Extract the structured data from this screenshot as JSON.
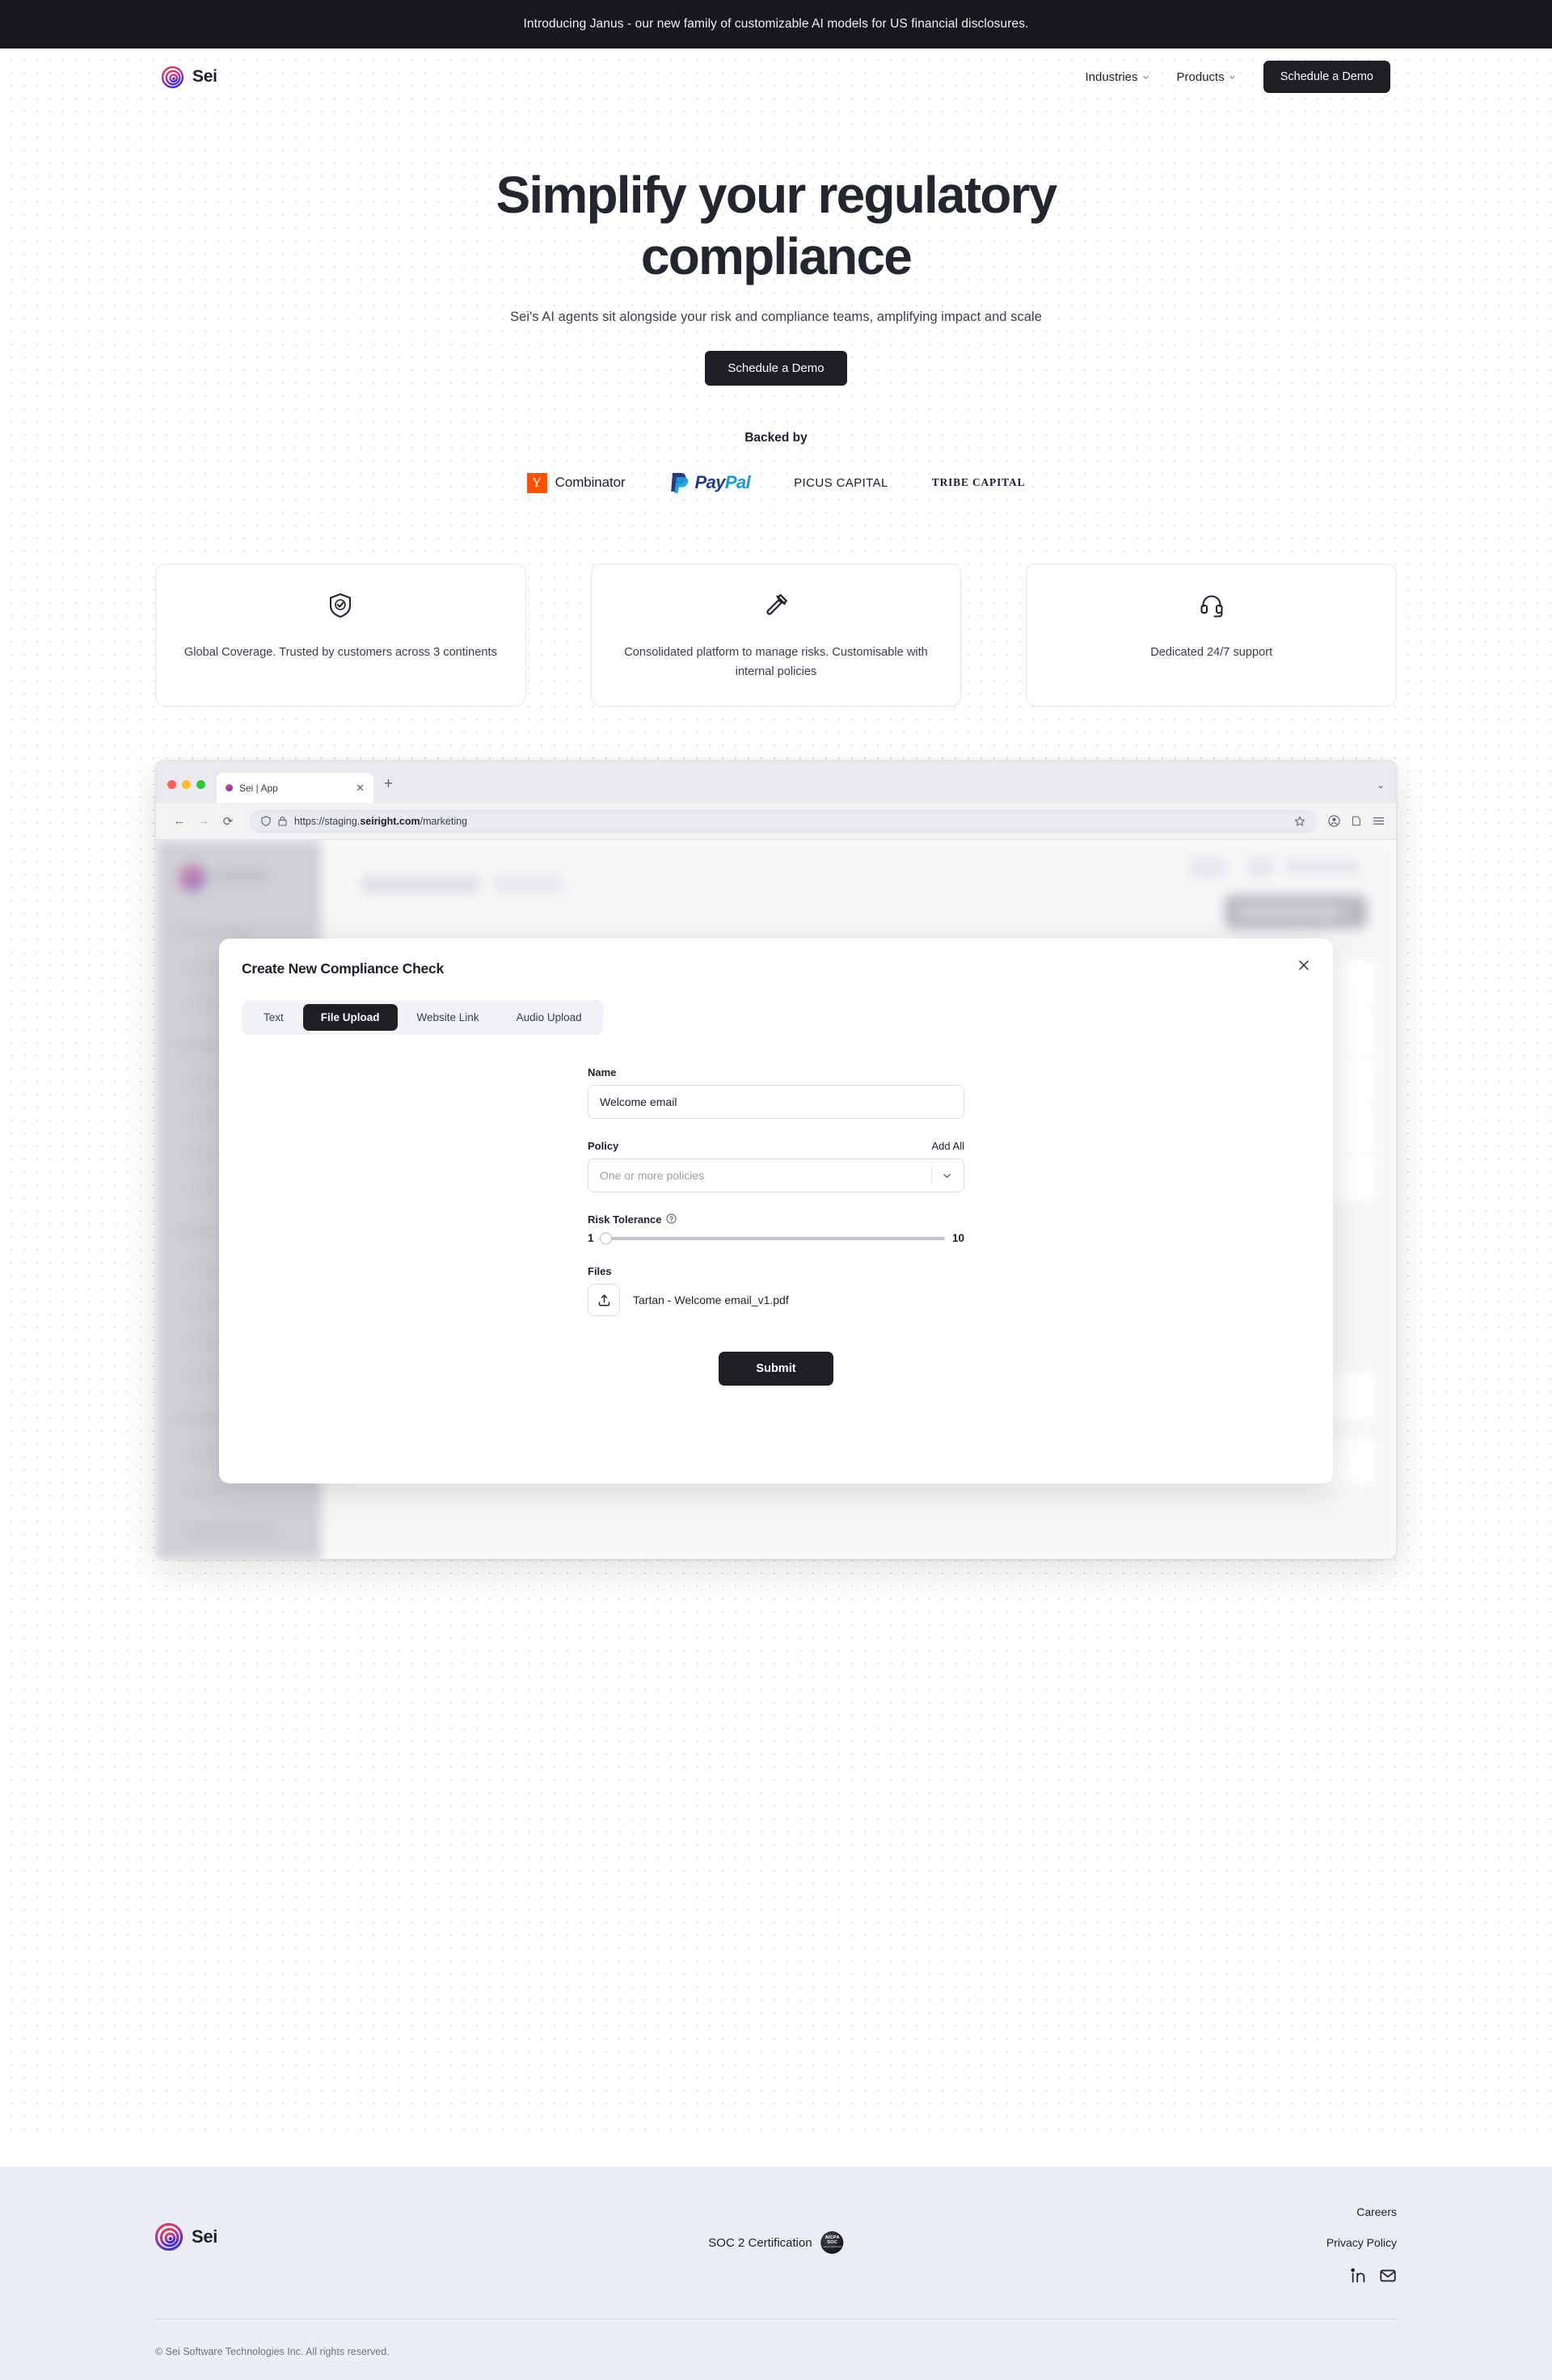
{
  "announcement": {
    "text": "Introducing Janus - our new family of customizable AI models for US financial disclosures."
  },
  "nav": {
    "brand": "Sei",
    "links": [
      {
        "label": "Industries"
      },
      {
        "label": "Products"
      }
    ],
    "cta": "Schedule a Demo"
  },
  "hero": {
    "heading": "Simplify your regulatory compliance",
    "subheading": "Sei's AI agents sit alongside your risk and compliance teams, amplifying impact and scale",
    "cta": "Schedule a Demo"
  },
  "backed_by": {
    "title": "Backed by",
    "logos": [
      {
        "name": "y-combinator",
        "mark": "Y",
        "label": "Combinator"
      },
      {
        "name": "paypal",
        "part1": "Pay",
        "part2": "Pal"
      },
      {
        "name": "picus-capital",
        "label": "PICUS CAPITAL"
      },
      {
        "name": "tribe-capital",
        "label": "TRIBE CAPITAL"
      }
    ]
  },
  "features": [
    {
      "icon": "shield-check-icon",
      "text": "Global Coverage. Trusted by customers across 3 continents"
    },
    {
      "icon": "gavel-icon",
      "text": "Consolidated platform to manage risks. Customisable with internal policies"
    },
    {
      "icon": "headset-icon",
      "text": "Dedicated 24/7 support"
    }
  ],
  "browser": {
    "tab_title": "Sei | App",
    "url_prefix": "https://staging.",
    "url_domain": "seiright.com",
    "url_suffix": "/marketing"
  },
  "modal": {
    "title": "Create New Compliance Check",
    "tabs": [
      {
        "label": "Text",
        "active": false
      },
      {
        "label": "File Upload",
        "active": true
      },
      {
        "label": "Website Link",
        "active": false
      },
      {
        "label": "Audio Upload",
        "active": false
      }
    ],
    "name_label": "Name",
    "name_value": "Welcome email",
    "policy_label": "Policy",
    "policy_add_all": "Add All",
    "policy_placeholder": "One or more policies",
    "risk_label": "Risk Tolerance",
    "risk_min": "1",
    "risk_max": "10",
    "files_label": "Files",
    "file_name": "Tartan - Welcome email_v1.pdf",
    "submit": "Submit"
  },
  "footer": {
    "brand": "Sei",
    "soc_label": "SOC 2 Certification",
    "soc_badge_line1": "AICPA",
    "soc_badge_line2": "SOC",
    "soc_badge_line3": "aicpa.org/soc4so",
    "links": [
      {
        "label": "Careers"
      },
      {
        "label": "Privacy Policy"
      }
    ],
    "copyright": "© Sei Software Technologies Inc. All rights reserved."
  },
  "colors": {
    "dark": "#1d1f24",
    "accent_pink": "#e8456b",
    "accent_purple": "#5a3fd6",
    "yc_orange": "#ff5100",
    "paypal_dark": "#253b80",
    "paypal_light": "#179bd7",
    "footer_bg": "#eceef5"
  }
}
